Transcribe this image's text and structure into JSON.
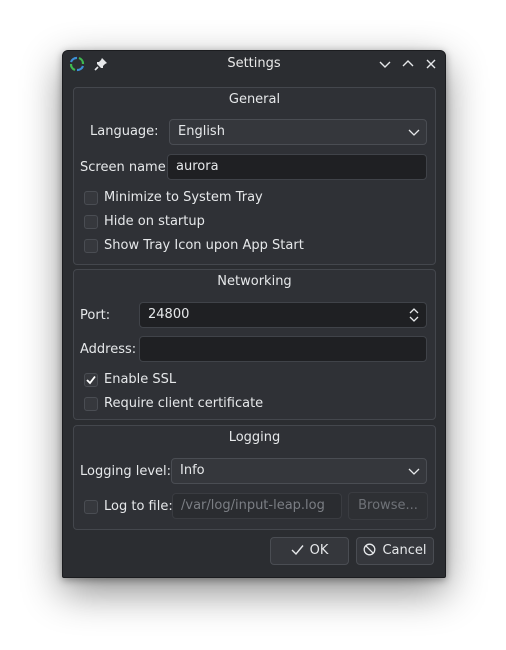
{
  "window": {
    "title": "Settings"
  },
  "general": {
    "title": "General",
    "language_label": "Language:",
    "language_value": "English",
    "screen_name_label": "Screen name:",
    "screen_name_value": "aurora",
    "minimize_label": "Minimize to System Tray",
    "minimize_checked": false,
    "hide_label": "Hide on startup",
    "hide_checked": false,
    "tray_label": "Show Tray Icon upon App Start",
    "tray_checked": false
  },
  "networking": {
    "title": "Networking",
    "port_label": "Port:",
    "port_value": "24800",
    "address_label": "Address:",
    "address_value": "",
    "ssl_label": "Enable SSL",
    "ssl_checked": true,
    "cert_label": "Require client certificate",
    "cert_checked": false
  },
  "logging": {
    "title": "Logging",
    "level_label": "Logging level:",
    "level_value": "Info",
    "logfile_label": "Log to file:",
    "logfile_checked": false,
    "logfile_path": "/var/log/input-leap.log",
    "browse_label": "Browse..."
  },
  "buttons": {
    "ok_label": "OK",
    "cancel_label": "Cancel"
  },
  "icons": {
    "app": "input-leap-app-icon",
    "pin": "pin-icon",
    "minimize": "chevron-down-icon",
    "maximize": "chevron-up-icon",
    "close": "close-icon",
    "ok": "checkmark-icon",
    "cancel": "cancel-circle-icon"
  },
  "colors": {
    "window_bg": "#2b2d31",
    "accent_green": "#3fb950",
    "accent_blue": "#3d8fd6"
  }
}
